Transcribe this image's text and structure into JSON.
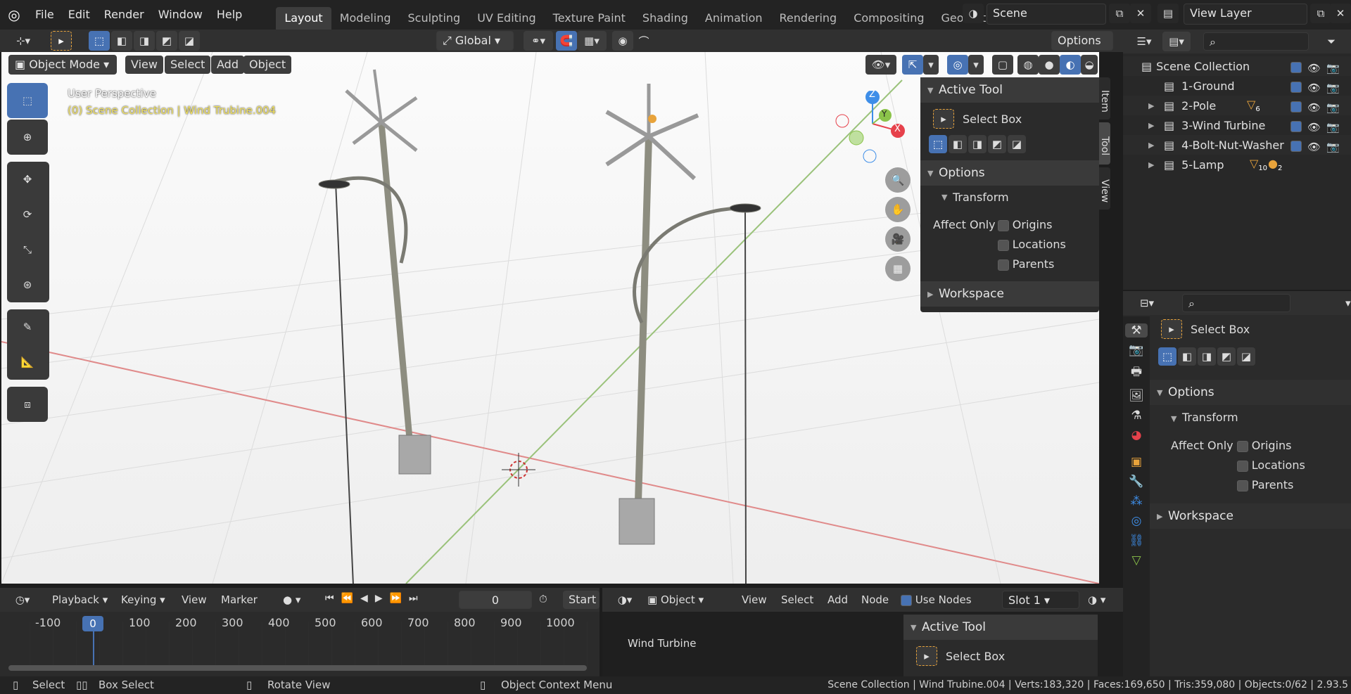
{
  "menus": [
    "File",
    "Edit",
    "Render",
    "Window",
    "Help"
  ],
  "workspace_tabs": [
    "Layout",
    "Modeling",
    "Sculpting",
    "UV Editing",
    "Texture Paint",
    "Shading",
    "Animation",
    "Rendering",
    "Compositing",
    "Geometry Nod"
  ],
  "scene": "Scene",
  "view_layer": "View Layer",
  "toolbar": {
    "orientation": "Global",
    "options": "Options"
  },
  "viewport_header": {
    "mode": "Object Mode",
    "menus": [
      "View",
      "Select",
      "Add",
      "Object"
    ]
  },
  "viewport": {
    "perspective": "User Perspective",
    "info": "(0) Scene Collection | Wind Trubine.004"
  },
  "gizmo": {
    "x": "X",
    "y": "Y",
    "z": "Z"
  },
  "npanel_tabs": [
    "Item",
    "Tool",
    "View"
  ],
  "npanel": {
    "active_tool": "Active Tool",
    "tool_name": "Select Box",
    "options": "Options",
    "transform": "Transform",
    "affect_only": "Affect Only",
    "origins": "Origins",
    "locations": "Locations",
    "parents": "Parents",
    "workspace": "Workspace"
  },
  "outliner": {
    "root": "Scene Collection",
    "items": [
      {
        "name": "1-Ground",
        "badge": ""
      },
      {
        "name": "2-Pole",
        "badge": "6"
      },
      {
        "name": "3-Wind Turbine",
        "badge": ""
      },
      {
        "name": "4-Bolt-Nut-Washer",
        "badge": ""
      },
      {
        "name": "5-Lamp",
        "badge": "10",
        "badge2": "2"
      }
    ]
  },
  "properties": {
    "tool_name": "Select Box",
    "options": "Options",
    "transform": "Transform",
    "affect_only": "Affect Only",
    "origins": "Origins",
    "locations": "Locations",
    "parents": "Parents",
    "workspace": "Workspace"
  },
  "timeline": {
    "menus": [
      "Playback",
      "Keying",
      "View",
      "Marker"
    ],
    "frame": "0",
    "start": "Start",
    "ticks": [
      "-100",
      "0",
      "100",
      "200",
      "300",
      "400",
      "500",
      "600",
      "700",
      "800",
      "900",
      "1000"
    ]
  },
  "shader": {
    "object": "Object",
    "menus": [
      "View",
      "Select",
      "Add",
      "Node"
    ],
    "use_nodes": "Use Nodes",
    "slot": "Slot 1",
    "node_label": "Wind Turbine",
    "active_tool": "Active Tool",
    "tool_name": "Select Box"
  },
  "status": {
    "select": "Select",
    "box_select": "Box Select",
    "rotate": "Rotate View",
    "context": "Object Context Menu",
    "stats": "Scene Collection | Wind Trubine.004 | Verts:183,320 | Faces:169,650 | Tris:359,080 | Objects:0/62 | 2.93.5"
  },
  "colors": {
    "accent": "#4772b3",
    "x_axis": "#e6414b",
    "y_axis": "#8bc34a",
    "z_axis": "#3e8ee8",
    "header": "#2f2f2f"
  }
}
